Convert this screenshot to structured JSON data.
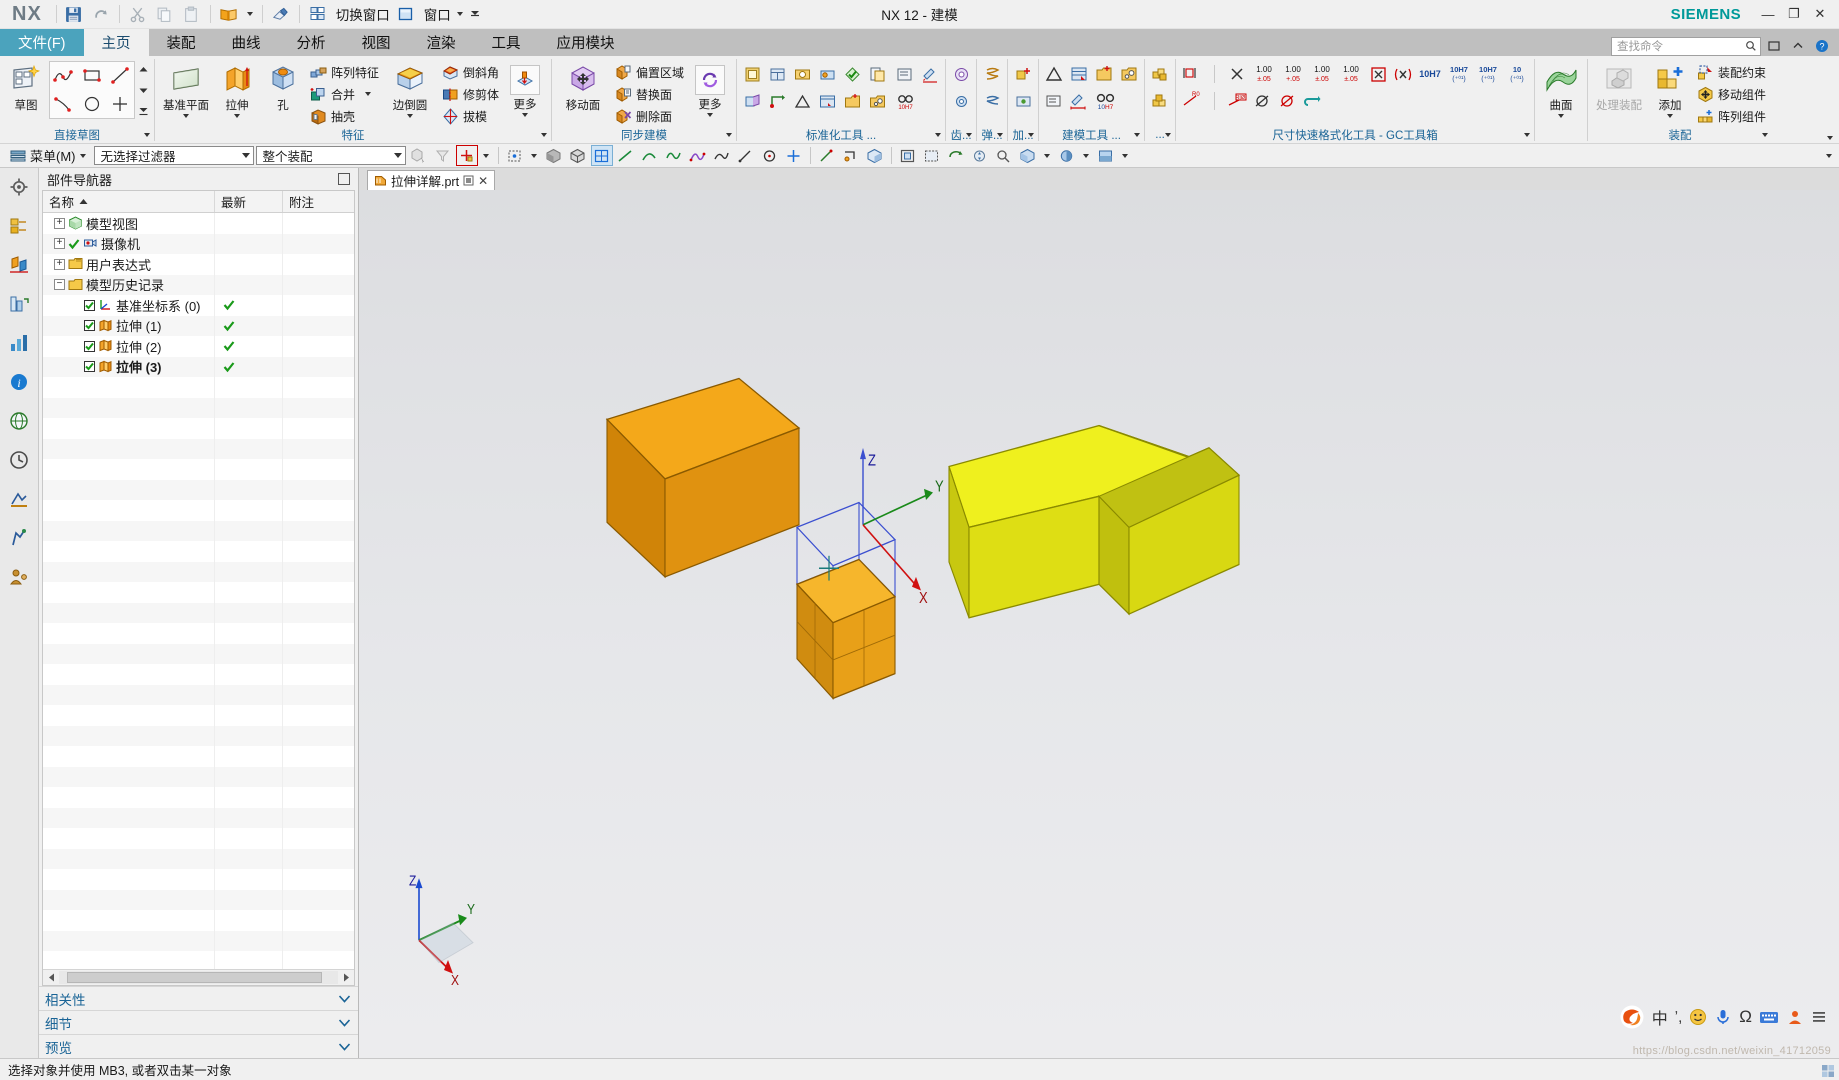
{
  "title_bar": {
    "app_logo": "NX",
    "window_title": "NX 12 - 建模",
    "brand": "SIEMENS",
    "quick_access": [
      {
        "name": "save",
        "label": ""
      },
      {
        "name": "redo",
        "label": ""
      },
      {
        "name": "cut",
        "label": ""
      },
      {
        "name": "copy",
        "label": ""
      },
      {
        "name": "paste",
        "label": ""
      },
      {
        "name": "open-book",
        "label": ""
      },
      {
        "name": "eraser",
        "label": ""
      }
    ],
    "switch_window_label": "切换窗口",
    "window_label": "窗口",
    "minimize": "—",
    "restore": "❐",
    "close": "✕"
  },
  "tabs": [
    {
      "label": "文件(F)",
      "state": "file"
    },
    {
      "label": "主页",
      "state": "active"
    },
    {
      "label": "装配",
      "state": "normal"
    },
    {
      "label": "曲线",
      "state": "normal"
    },
    {
      "label": "分析",
      "state": "normal"
    },
    {
      "label": "视图",
      "state": "normal"
    },
    {
      "label": "渲染",
      "state": "normal"
    },
    {
      "label": "工具",
      "state": "normal"
    },
    {
      "label": "应用模块",
      "state": "normal"
    }
  ],
  "search": {
    "placeholder": "查找命令",
    "icon": "search-icon"
  },
  "ribbon": {
    "groups": [
      {
        "label": "直接草图",
        "big_buttons": [
          {
            "label": "草图",
            "icon": "sketch-icon",
            "dropdown": false
          }
        ],
        "gallery": [
          "profile-icon",
          "rectangle-icon",
          "line-icon",
          "arc-icon",
          "circle-icon",
          "point-icon"
        ]
      },
      {
        "label": "特征",
        "big_buttons": [
          {
            "label": "基准平面",
            "icon": "datum-plane-icon",
            "dropdown": true
          },
          {
            "label": "拉伸",
            "icon": "extrude-icon",
            "dropdown": true
          },
          {
            "label": "孔",
            "icon": "hole-icon",
            "dropdown": false
          },
          {
            "label": "边倒圆",
            "icon": "edge-blend-icon",
            "dropdown": true
          },
          {
            "label": "更多",
            "icon": "more-feature-icon",
            "dropdown": true
          }
        ],
        "small_buttons_1": [
          {
            "label": "阵列特征",
            "icon": "pattern-feature-icon",
            "dropdown": false
          },
          {
            "label": "合并",
            "icon": "unite-icon",
            "dropdown": true
          },
          {
            "label": "抽壳",
            "icon": "shell-icon",
            "dropdown": false
          }
        ],
        "small_buttons_2": [
          {
            "label": "倒斜角",
            "icon": "chamfer-icon",
            "dropdown": false
          },
          {
            "label": "修剪体",
            "icon": "trim-body-icon",
            "dropdown": false
          },
          {
            "label": "拔模",
            "icon": "draft-icon",
            "dropdown": false
          }
        ]
      },
      {
        "label": "同步建模",
        "big_buttons": [
          {
            "label": "移动面",
            "icon": "move-face-icon",
            "dropdown": false
          },
          {
            "label": "更多",
            "icon": "sync-more-icon",
            "dropdown": true
          }
        ],
        "small_buttons_1": [
          {
            "label": "偏置区域",
            "icon": "offset-region-icon",
            "dropdown": false
          },
          {
            "label": "替换面",
            "icon": "replace-face-icon",
            "dropdown": false
          },
          {
            "label": "删除面",
            "icon": "delete-face-icon",
            "dropdown": false
          }
        ]
      },
      {
        "label": "标准化工具 ...",
        "icon_grid": true
      },
      {
        "label": "齿...",
        "icon_grid": true
      },
      {
        "label": "弹...",
        "icon_grid": true
      },
      {
        "label": "加...",
        "icon_grid": true
      },
      {
        "label": "建模工具 ...",
        "icon_grid": true
      },
      {
        "label": "...",
        "icon_grid": true
      },
      {
        "label": "尺寸快速格式化工具 - GC工具箱",
        "icon_grid": true
      },
      {
        "label": "",
        "big_buttons": [
          {
            "label": "曲面",
            "icon": "surface-icon",
            "dropdown": true
          }
        ]
      },
      {
        "label": "装配",
        "big_buttons": [
          {
            "label": "处理装配",
            "icon": "manage-assembly-icon",
            "dropdown": false,
            "disabled": true
          },
          {
            "label": "添加",
            "icon": "add-component-icon",
            "dropdown": true
          }
        ],
        "small_buttons_1": [
          {
            "label": "装配约束",
            "icon": "assembly-constraint-icon",
            "dropdown": false
          },
          {
            "label": "移动组件",
            "icon": "move-component-icon",
            "dropdown": false
          },
          {
            "label": "阵列组件",
            "icon": "pattern-component-icon",
            "dropdown": false
          }
        ]
      }
    ]
  },
  "selection_toolbar": {
    "menu_label": "菜单(M)",
    "filter_value": "无选择过滤器",
    "scope_value": "整个装配"
  },
  "navigator": {
    "panel_title": "部件导航器",
    "columns": [
      "名称",
      "最新",
      "附注"
    ],
    "rows": [
      {
        "label": "模型视图",
        "indent": 0,
        "expander": "+",
        "icon": "model-views-icon",
        "checkbox": false,
        "check": "",
        "bold": false
      },
      {
        "label": "摄像机",
        "indent": 0,
        "expander": "+",
        "icon": "camera-icon",
        "checkbox": false,
        "check": "✔",
        "bold": false,
        "pre_check": true
      },
      {
        "label": "用户表达式",
        "indent": 0,
        "expander": "+",
        "icon": "folder-icon",
        "checkbox": false,
        "check": "",
        "bold": false
      },
      {
        "label": "模型历史记录",
        "indent": 0,
        "expander": "−",
        "icon": "folder-icon",
        "checkbox": false,
        "check": "",
        "bold": false
      },
      {
        "label": "基准坐标系 (0)",
        "indent": 1,
        "expander": "",
        "icon": "datum-csys-icon",
        "checkbox": true,
        "check": "✔",
        "bold": false
      },
      {
        "label": "拉伸 (1)",
        "indent": 1,
        "expander": "",
        "icon": "extrude-small-icon",
        "checkbox": true,
        "check": "✔",
        "bold": false
      },
      {
        "label": "拉伸 (2)",
        "indent": 1,
        "expander": "",
        "icon": "extrude-small-icon",
        "checkbox": true,
        "check": "✔",
        "bold": false
      },
      {
        "label": "拉伸 (3)",
        "indent": 1,
        "expander": "",
        "icon": "extrude-small-icon",
        "checkbox": true,
        "check": "✔",
        "bold": true
      }
    ],
    "sections": [
      "相关性",
      "细节",
      "预览"
    ]
  },
  "document_tab": {
    "name": "拉伸详解.prt",
    "close": "✕"
  },
  "status_bar": {
    "message": "选择对象并使用 MB3, 或者双击某一对象"
  },
  "ime": {
    "logo": "S",
    "mode_label": "中",
    "items": [
      "comma-icon",
      "smiley-icon",
      "mic-icon",
      "omega-icon",
      "keyboard-icon",
      "user-icon",
      "menu-icon"
    ]
  },
  "watermark": "https://blog.csdn.net/weixin_41712059",
  "viewport": {
    "background_top": "#dfe0e2",
    "background_bottom": "#e9eaec",
    "triad_labels": [
      "Z",
      "Y",
      "X"
    ],
    "wcs_labels": [
      "Z",
      "Y",
      "X"
    ],
    "bodies": [
      {
        "name": "orange-block",
        "color_top": "#f2a814",
        "color_front": "#d88b0a",
        "color_side": "#c87f08"
      },
      {
        "name": "small-orange-cube",
        "color_top": "#f5b32a",
        "color_front": "#d98f10",
        "color_side": "#c98309"
      },
      {
        "name": "yellow-frame",
        "color_top": "#e8e81e",
        "color_front": "#d6d614",
        "color_side": "#b8b80c"
      }
    ],
    "sketch_color": "#3b4fd0"
  },
  "colors": {
    "accent_blue": "#1a6496",
    "file_tab": "#4ba3bd",
    "siemens_teal": "#009999",
    "ribbon_bg": "#f0f0f0",
    "tabbar_bg": "#bfbfbf"
  }
}
